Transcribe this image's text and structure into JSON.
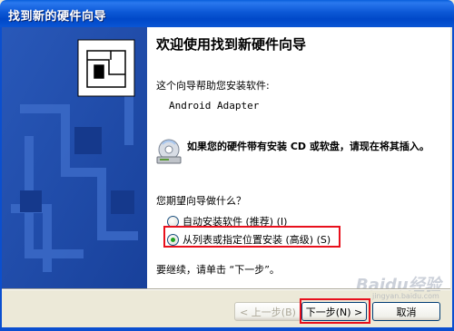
{
  "window": {
    "title": "找到新的硬件向导"
  },
  "wizard": {
    "heading": "欢迎使用找到新硬件向导",
    "intro": "这个向导帮助您安装软件:",
    "device_name": "Android Adapter",
    "cd_text": "如果您的硬件带有安装 CD 或软盘，请现在将其插入。",
    "question": "您期望向导做什么？",
    "options": [
      {
        "label": "自动安装软件 (推荐) (I)",
        "checked": false
      },
      {
        "label": "从列表或指定位置安装 (高级) (S)",
        "checked": true
      }
    ],
    "continue_text": "要继续，请单击 “下一步”。"
  },
  "buttons": {
    "back": "< 上一步(B)",
    "next": "下一步(N) >",
    "cancel": "取消"
  },
  "watermark": {
    "brand": "Baidu经验",
    "url": "jingyan.baidu.com"
  }
}
